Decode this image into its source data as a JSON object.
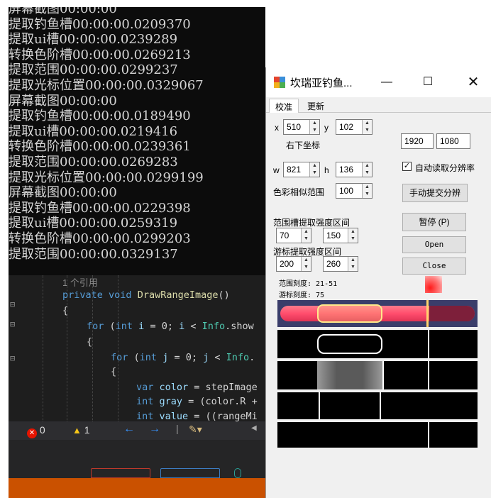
{
  "console": {
    "lines": [
      "屏幕截图00:00:00",
      "提取钓鱼槽00:00:00.0209370",
      "提取ui槽00:00:00.0239289",
      "转换色阶槽00:00:00.0269213",
      "提取范围00:00:00.0299237",
      "提取光标位置00:00:00.0329067",
      "屏幕截图00:00:00",
      "提取钓鱼槽00:00:00.0189490",
      "提取ui槽00:00:00.0219416",
      "转换色阶槽00:00:00.0239361",
      "提取范围00:00:00.0269283",
      "提取光标位置00:00:00.0299199",
      "屏幕截图00:00:00",
      "提取钓鱼槽00:00:00.0229398",
      "提取ui槽00:00:00.0259319",
      "转换色阶槽00:00:00.0299203",
      "提取范围00:00:00.0329137"
    ]
  },
  "editor": {
    "refs": "1 个引用",
    "l1": {
      "kw1": "private",
      "kw2": "void",
      "fn": "DrawRangeImage",
      "rest": "()"
    },
    "l2": "{",
    "l3": {
      "kw": "for",
      "p1": " (",
      "ty": "int",
      "id": " i",
      "p2": " = 0; ",
      "id2": "i",
      "p3": " < ",
      "cls": "Info",
      "p4": ".show"
    },
    "l4": "{",
    "l5": {
      "kw": "for",
      "p1": " (",
      "ty": "int",
      "id": " j",
      "p2": " = 0; ",
      "id2": "j",
      "p3": " < ",
      "cls": "Info",
      "p4": "."
    },
    "l6": "{",
    "l7": {
      "kw": "var",
      "id": " color",
      "p": " = stepImage"
    },
    "l8": {
      "ty": "int",
      "id": " gray",
      "p": " = (color.R +"
    },
    "l9": {
      "ty": "int",
      "id": " value",
      "p": " = ((rangeMi"
    }
  },
  "errors": {
    "error_count": "0",
    "warning_count": "1"
  },
  "dialog": {
    "title": "坎瑞亚钓鱼...",
    "tabs": [
      "校准",
      "更新"
    ],
    "x_label": "x",
    "x_value": "510",
    "y_label": "y",
    "y_value": "102",
    "bottom_right_label": "右下坐标",
    "screen_w": "1920",
    "screen_h": "1080",
    "w_label": "w",
    "w_value": "821",
    "h_label": "h",
    "h_value": "136",
    "auto_read_label": "自动读取分辨率",
    "color_sim_label": "色彩相似范围",
    "color_sim_value": "100",
    "manual_res_button": "手动提交分辨",
    "range_slot_label": "范围槽提取强度区间",
    "range_min": "70",
    "range_max": "150",
    "cursor_label": "游标提取强度区间",
    "cursor_min": "200",
    "cursor_max": "260",
    "pause_button": "暂停 (P)",
    "open_button": "Open",
    "close_button": "Close",
    "range_scale": "范围刻度: 21-51",
    "cursor_scale": "游标刻度: 75"
  }
}
